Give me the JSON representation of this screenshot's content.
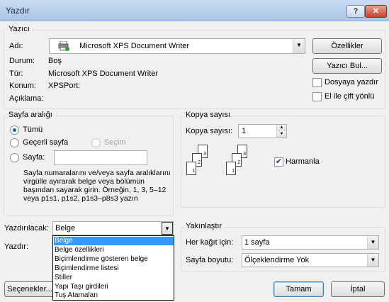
{
  "window": {
    "title": "Yazdır",
    "help_label": "?",
    "close_label": "✕"
  },
  "printer": {
    "group_label": "Yazıcı",
    "name_label": "Adı:",
    "name_value": "Microsoft XPS Document Writer",
    "status_label": "Durum:",
    "status_value": "Boş",
    "type_label": "Tür:",
    "type_value": "Microsoft XPS Document Writer",
    "location_label": "Konum:",
    "location_value": "XPSPort:",
    "comment_label": "Açıklama:",
    "properties_button": "Özellikler",
    "find_printer_button": "Yazıcı Bul...",
    "print_to_file_label": "Dosyaya yazdır",
    "manual_duplex_label": "El ile çift yönlü"
  },
  "page_range": {
    "group_label": "Sayfa aralığı",
    "all_label": "Tümü",
    "current_label": "Geçerli sayfa",
    "selection_label": "Seçim",
    "pages_label": "Sayfa:",
    "pages_value": "",
    "help_text": "Sayfa numaralarını ve/veya sayfa aralıklarını virgülle ayırarak belge veya bölümün başından sayarak girin. Örneğin, 1, 3, 5–12 veya p1s1, p1s2, p1s3–p8s3 yazın"
  },
  "copies": {
    "group_label": "Kopya sayısı",
    "copies_label": "Kopya sayısı:",
    "copies_value": "1",
    "collate_label": "Harmanla",
    "page_numbers": [
      "1",
      "2",
      "3"
    ]
  },
  "print_what": {
    "label": "Yazdırılacak:",
    "value": "Belge",
    "options": [
      "Belge",
      "Belge özellikleri",
      "Biçimlendirme gösteren belge",
      "Biçimlendirme listesi",
      "Stiller",
      "Yapı Taşı girdileri",
      "Tuş Atamaları"
    ]
  },
  "print_label": "Yazdır:",
  "zoom": {
    "group_label": "Yakınlaştır",
    "pages_per_sheet_label": "Her kağıt için:",
    "pages_per_sheet_value": "1 sayfa",
    "scale_label": "Sayfa boyutu:",
    "scale_value": "Ölçeklendirme Yok"
  },
  "buttons": {
    "options": "Seçenekler...",
    "ok": "Tamam",
    "cancel": "İptal"
  }
}
